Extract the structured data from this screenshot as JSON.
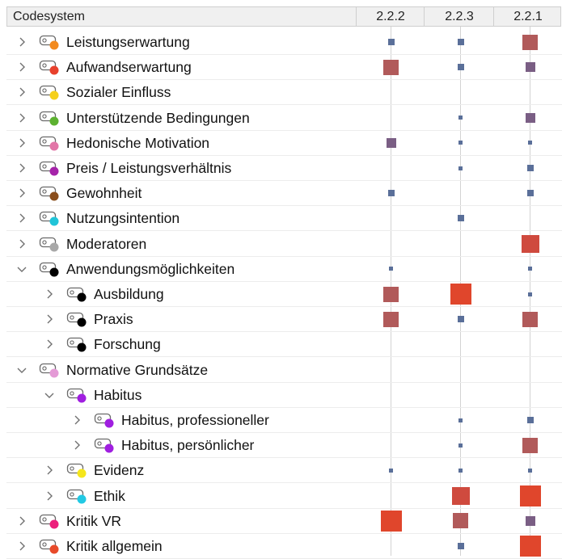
{
  "header": {
    "title": "Codesystem",
    "columns": [
      "2.2.2",
      "2.2.3",
      "2.2.1"
    ]
  },
  "rows": [
    {
      "label": "Leistungserwartung",
      "level": 0,
      "expanded": false,
      "color": "#f28a1e",
      "cells": [
        1,
        1,
        3
      ]
    },
    {
      "label": "Aufwandserwartung",
      "level": 0,
      "expanded": false,
      "color": "#e8402c",
      "cells": [
        3,
        1,
        2
      ]
    },
    {
      "label": "Sozialer Einfluss",
      "level": 0,
      "expanded": false,
      "color": "#f5d01c",
      "cells": [
        0,
        0,
        0
      ]
    },
    {
      "label": "Unterstützende Bedingungen",
      "level": 0,
      "expanded": false,
      "color": "#5cb130",
      "cells": [
        0,
        0.5,
        2
      ]
    },
    {
      "label": "Hedonische Motivation",
      "level": 0,
      "expanded": false,
      "color": "#e276a8",
      "cells": [
        2,
        0.5,
        0.5
      ]
    },
    {
      "label": "Preis / Leistungsverhältnis",
      "level": 0,
      "expanded": false,
      "color": "#a523a9",
      "cells": [
        0,
        0.5,
        1
      ]
    },
    {
      "label": "Gewohnheit",
      "level": 0,
      "expanded": false,
      "color": "#8a4e1c",
      "cells": [
        1,
        0,
        1
      ]
    },
    {
      "label": "Nutzungsintention",
      "level": 0,
      "expanded": false,
      "color": "#20c4d8",
      "cells": [
        0,
        1,
        0
      ]
    },
    {
      "label": "Moderatoren",
      "level": 0,
      "expanded": false,
      "color": "#a8a8a8",
      "cells": [
        0,
        0,
        4
      ]
    },
    {
      "label": "Anwendungsmöglichkeiten",
      "level": 0,
      "expanded": true,
      "color": "#000000",
      "cells": [
        0.5,
        0,
        0.5
      ]
    },
    {
      "label": "Ausbildung",
      "level": 1,
      "expanded": false,
      "color": "#000000",
      "cells": [
        3,
        5,
        0.5
      ]
    },
    {
      "label": "Praxis",
      "level": 1,
      "expanded": false,
      "color": "#000000",
      "cells": [
        3,
        1,
        3
      ]
    },
    {
      "label": "Forschung",
      "level": 1,
      "expanded": false,
      "color": "#000000",
      "cells": [
        0,
        0,
        0
      ]
    },
    {
      "label": "Normative Grundsätze",
      "level": 0,
      "expanded": true,
      "color": "#e49ad6",
      "cells": [
        0,
        0,
        0
      ]
    },
    {
      "label": "Habitus",
      "level": 1,
      "expanded": true,
      "color": "#a01fe0",
      "cells": [
        0,
        0,
        0
      ]
    },
    {
      "label": "Habitus, professioneller",
      "level": 2,
      "expanded": false,
      "color": "#a01fe0",
      "cells": [
        0,
        0.5,
        1
      ]
    },
    {
      "label": "Habitus, persönlicher",
      "level": 2,
      "expanded": false,
      "color": "#a01fe0",
      "cells": [
        0,
        0.5,
        3
      ]
    },
    {
      "label": "Evidenz",
      "level": 1,
      "expanded": false,
      "color": "#f5e61c",
      "cells": [
        0.5,
        0.5,
        0.5
      ]
    },
    {
      "label": "Ethik",
      "level": 1,
      "expanded": false,
      "color": "#22c9e4",
      "cells": [
        0,
        4,
        5
      ]
    },
    {
      "label": "Kritik VR",
      "level": 0,
      "expanded": false,
      "color": "#ec1f7c",
      "cells": [
        5,
        3,
        2
      ]
    },
    {
      "label": "Kritik allgemein",
      "level": 0,
      "expanded": false,
      "color": "#e84a2a",
      "cells": [
        0,
        1,
        5
      ]
    }
  ],
  "colors": {
    "small": "#5a6f99",
    "medium": "#7a5e84",
    "large": "#b15a5a",
    "xlarge": "#cf4a3e",
    "max": "#e0462c"
  }
}
